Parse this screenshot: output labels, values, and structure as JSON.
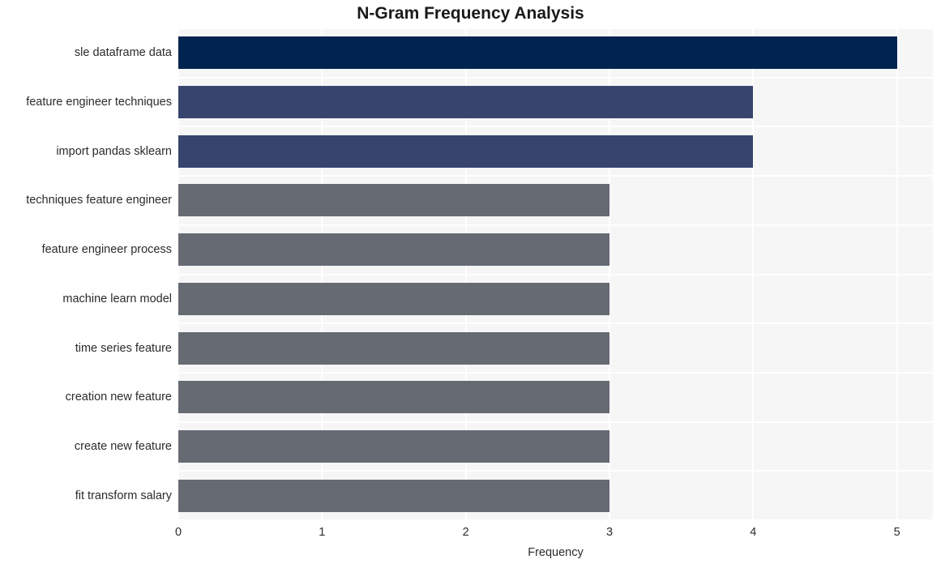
{
  "chart_data": {
    "type": "bar",
    "orientation": "horizontal",
    "title": "N-Gram Frequency Analysis",
    "xlabel": "Frequency",
    "ylabel": "",
    "xlim": [
      0,
      5.25
    ],
    "xticks": [
      "0",
      "1",
      "2",
      "3",
      "4",
      "5"
    ],
    "xtick_values": [
      0,
      1,
      2,
      3,
      4,
      5
    ],
    "grid": true,
    "legend": "none",
    "categories": [
      "sle dataframe data",
      "feature engineer techniques",
      "import pandas sklearn",
      "techniques feature engineer",
      "feature engineer process",
      "machine learn model",
      "time series feature",
      "creation new feature",
      "create new feature",
      "fit transform salary"
    ],
    "values": [
      5,
      4,
      4,
      3,
      3,
      3,
      3,
      3,
      3,
      3
    ],
    "bar_colors": [
      "#002350",
      "#37446e",
      "#37446e",
      "#666a73",
      "#666a73",
      "#666a73",
      "#666a73",
      "#666a73",
      "#666a73",
      "#666a73"
    ]
  },
  "style": {
    "figure_background": "#ffffff",
    "plot_background": "#f6f6f7",
    "gridline_color": "#ffffff",
    "text_color": "#2b2b2b",
    "title_color": "#1a1a1a"
  }
}
